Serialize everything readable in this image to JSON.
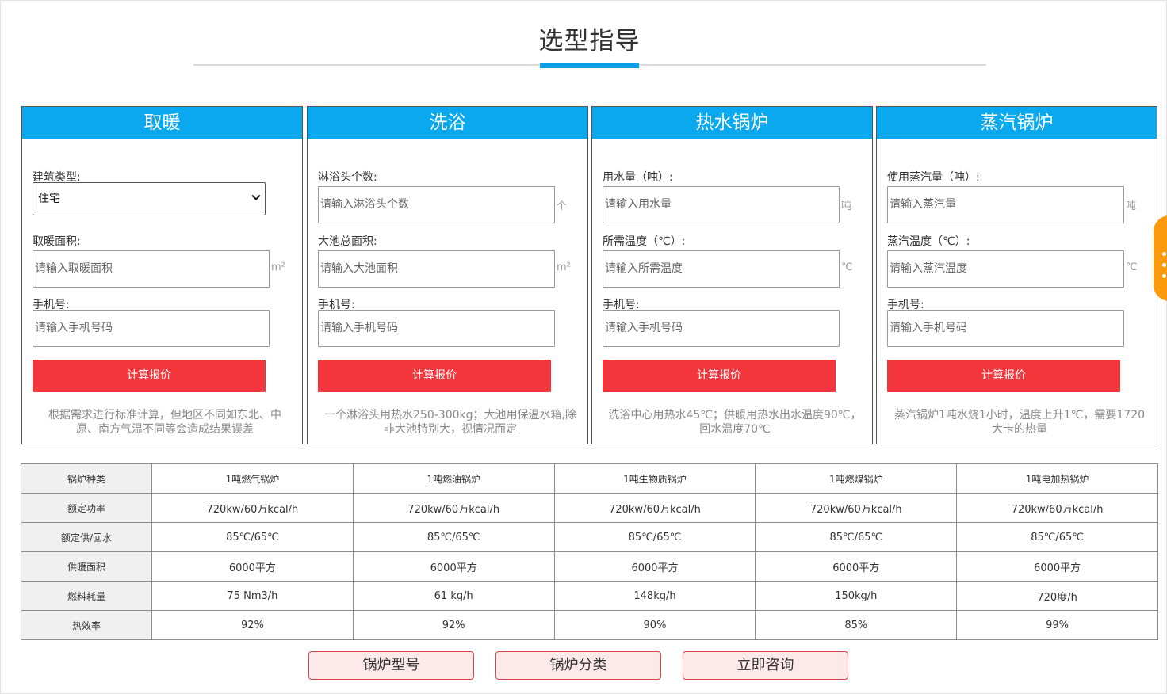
{
  "page": {
    "title": "选型指导"
  },
  "cards": [
    {
      "header": "取暖",
      "fields": [
        {
          "label": "建筑类型:",
          "type": "select",
          "value": "住宅"
        },
        {
          "label": "取暖面积:",
          "placeholder": "请输入取暖面积",
          "unit": "m²"
        },
        {
          "label": "手机号:",
          "placeholder": "请输入手机号码"
        }
      ],
      "button": "计算报价",
      "note": "根据需求进行标准计算，但地区不同如东北、中原、南方气温不同等会造成结果误差"
    },
    {
      "header": "洗浴",
      "fields": [
        {
          "label": "淋浴头个数:",
          "placeholder": "请输入淋浴头个数",
          "unit": "个"
        },
        {
          "label": "大池总面积:",
          "placeholder": "请输入大池面积",
          "unit": "m²"
        },
        {
          "label": "手机号:",
          "placeholder": "请输入手机号码"
        }
      ],
      "button": "计算报价",
      "note": "一个淋浴头用热水250-300kg；大池用保温水箱,除非大池特别大，视情况而定"
    },
    {
      "header": "热水锅炉",
      "fields": [
        {
          "label": "用水量（吨）:",
          "placeholder": "请输入用水量",
          "unit": "吨"
        },
        {
          "label": "所需温度（℃）:",
          "placeholder": "请输入所需温度",
          "unit": "℃"
        },
        {
          "label": "手机号:",
          "placeholder": "请输入手机号码"
        }
      ],
      "button": "计算报价",
      "note": "洗浴中心用热水45℃；供暖用热水出水温度90℃，回水温度70℃"
    },
    {
      "header": "蒸汽锅炉",
      "fields": [
        {
          "label": "使用蒸汽量（吨）:",
          "placeholder": "请输入蒸汽量",
          "unit": "吨"
        },
        {
          "label": "蒸汽温度（℃）:",
          "placeholder": "请输入蒸汽温度",
          "unit": "℃"
        },
        {
          "label": "手机号:",
          "placeholder": "请输入手机号码"
        }
      ],
      "button": "计算报价",
      "note": "蒸汽锅炉1吨水烧1小时，温度上升1℃，需要1720大卡的热量"
    }
  ],
  "table": {
    "rows": [
      [
        "锅炉种类",
        "1吨燃气锅炉",
        "1吨燃油锅炉",
        "1吨生物质锅炉",
        "1吨燃煤锅炉",
        "1吨电加热锅炉"
      ],
      [
        "额定功率",
        "720kw/60万kcal/h",
        "720kw/60万kcal/h",
        "720kw/60万kcal/h",
        "720kw/60万kcal/h",
        "720kw/60万kcal/h"
      ],
      [
        "额定供/回水",
        "85℃/65℃",
        "85℃/65℃",
        "85℃/65℃",
        "85℃/65℃",
        "85℃/65℃"
      ],
      [
        "供暖面积",
        "6000平方",
        "6000平方",
        "6000平方",
        "6000平方",
        "6000平方"
      ],
      [
        "燃料耗量",
        "75 Nm3/h",
        "61 kg/h",
        "148kg/h",
        "150kg/h",
        "720度/h"
      ],
      [
        "热效率",
        "92%",
        "92%",
        "90%",
        "85%",
        "99%"
      ]
    ]
  },
  "bottom_buttons": [
    "锅炉型号",
    "锅炉分类",
    "立即咨询"
  ],
  "colors": {
    "accent_blue": "#0aa8ee",
    "button_red": "#f2363b",
    "float_orange": "#fb9a0c"
  }
}
